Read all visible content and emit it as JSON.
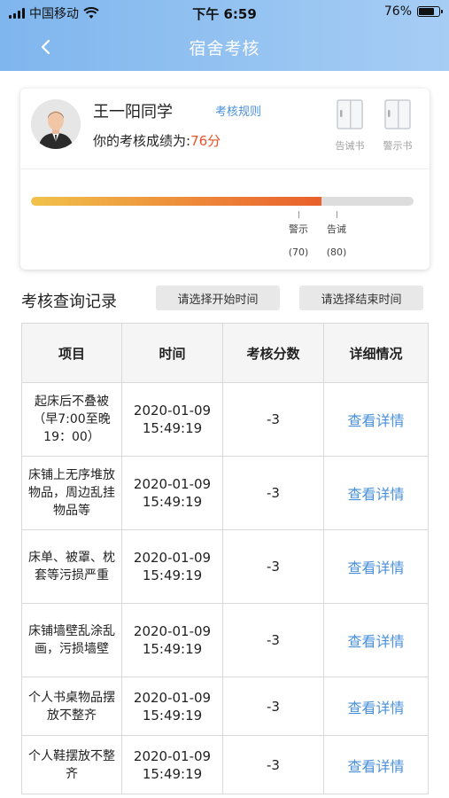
{
  "status_bar": {
    "carrier": "中国移动",
    "time": "下午 6:59",
    "battery_percent": "76%"
  },
  "nav": {
    "back_icon": "chevron-left-icon",
    "title": "宿舍考核"
  },
  "profile": {
    "name": "王一阳同学",
    "rules_link": "考核规则",
    "score_label": "你的考核成绩为:",
    "score_value": "76分",
    "score_number": 76,
    "score_color": "#e8532b",
    "docs": [
      {
        "label": "告诫书",
        "icon": "document-icon"
      },
      {
        "label": "警示书",
        "icon": "document-icon"
      }
    ]
  },
  "progress": {
    "fraction": 0.76,
    "markers": [
      {
        "label": "警示",
        "value": "(70)"
      },
      {
        "label": "告诫",
        "value": "(80)"
      }
    ]
  },
  "records": {
    "title": "考核查询记录",
    "start_placeholder": "请选择开始时间",
    "end_placeholder": "请选择结束时间",
    "columns": [
      "项目",
      "时间",
      "考核分数",
      "详细情况"
    ],
    "rows": [
      {
        "item": "起床后不叠被（早7:00至晚19：00）",
        "date": "2020-01-09",
        "clock": "15:49:19",
        "score": "-3",
        "detail": "查看详情"
      },
      {
        "item": "床铺上无序堆放物品，周边乱挂物品等",
        "date": "2020-01-09",
        "clock": "15:49:19",
        "score": "-3",
        "detail": "查看详情"
      },
      {
        "item": "床单、被罩、枕套等污损严重",
        "date": "2020-01-09",
        "clock": "15:49:19",
        "score": "-3",
        "detail": "查看详情"
      },
      {
        "item": "床铺墙壁乱涂乱画，污损墙壁",
        "date": "2020-01-09",
        "clock": "15:49:19",
        "score": "-3",
        "detail": "查看详情"
      },
      {
        "item": "个人书桌物品摆放不整齐",
        "date": "2020-01-09",
        "clock": "15:49:19",
        "score": "-3",
        "detail": "查看详情"
      },
      {
        "item": "个人鞋摆放不整齐",
        "date": "2020-01-09",
        "clock": "15:49:19",
        "score": "-3",
        "detail": "查看详情"
      }
    ]
  },
  "colors": {
    "header_start": "#7fb6ee",
    "header_end": "#a6cdf4",
    "link": "#4a90d9",
    "score": "#e8532b"
  }
}
